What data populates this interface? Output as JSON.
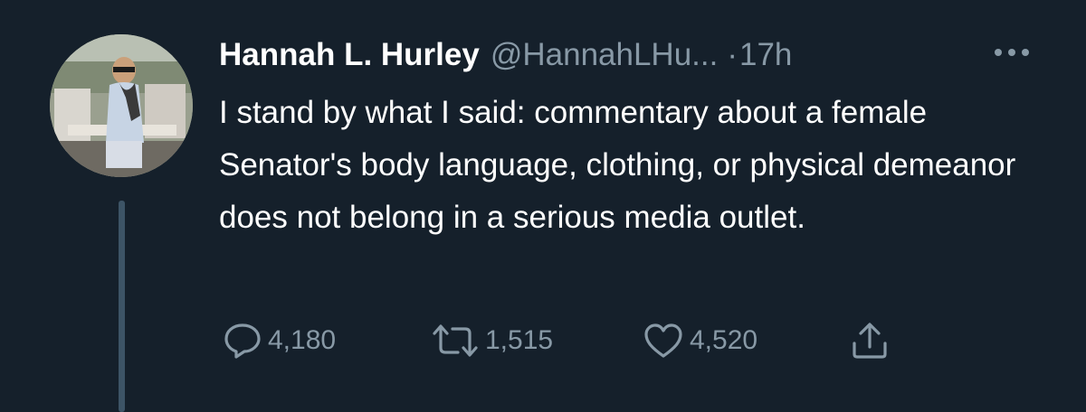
{
  "tweet": {
    "author_name": "Hannah L. Hurley",
    "author_handle": "@HannahLHu...",
    "separator": "·",
    "timestamp": "17h",
    "text": "I stand by what I said: commentary about a female Senator's body language, clothing, or physical demeanor does not belong in a serious media outlet."
  },
  "actions": {
    "reply": {
      "icon": "reply-icon",
      "count": "4,180"
    },
    "retweet": {
      "icon": "retweet-icon",
      "count": "1,515"
    },
    "like": {
      "icon": "heart-icon",
      "count": "4,520"
    },
    "share": {
      "icon": "share-icon"
    }
  },
  "colors": {
    "background": "#15202b",
    "primary_text": "#ffffff",
    "secondary_text": "#8899a6",
    "thread_line": "#3d5466"
  }
}
